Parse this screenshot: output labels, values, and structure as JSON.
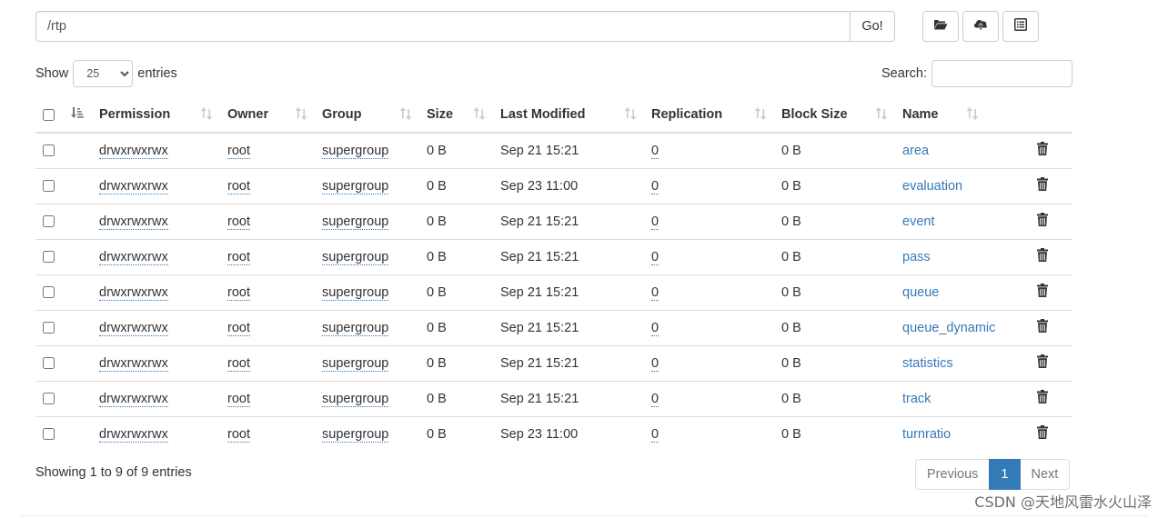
{
  "path": {
    "value": "/rtp",
    "go_label": "Go!"
  },
  "toolbar": {
    "buttons": [
      "folder-open-icon",
      "cloud-upload-icon",
      "list-alt-icon"
    ]
  },
  "length": {
    "prefix": "Show",
    "selected": "25",
    "suffix": "entries"
  },
  "filter": {
    "label": "Search:",
    "value": ""
  },
  "table": {
    "headers": [
      "Permission",
      "Owner",
      "Group",
      "Size",
      "Last Modified",
      "Replication",
      "Block Size",
      "Name"
    ],
    "rows": [
      {
        "permission": "drwxrwxrwx",
        "owner": "root",
        "group": "supergroup",
        "size": "0 B",
        "modified": "Sep 21 15:21",
        "replication": "0",
        "block_size": "0 B",
        "name": "area"
      },
      {
        "permission": "drwxrwxrwx",
        "owner": "root",
        "group": "supergroup",
        "size": "0 B",
        "modified": "Sep 23 11:00",
        "replication": "0",
        "block_size": "0 B",
        "name": "evaluation"
      },
      {
        "permission": "drwxrwxrwx",
        "owner": "root",
        "group": "supergroup",
        "size": "0 B",
        "modified": "Sep 21 15:21",
        "replication": "0",
        "block_size": "0 B",
        "name": "event"
      },
      {
        "permission": "drwxrwxrwx",
        "owner": "root",
        "group": "supergroup",
        "size": "0 B",
        "modified": "Sep 21 15:21",
        "replication": "0",
        "block_size": "0 B",
        "name": "pass"
      },
      {
        "permission": "drwxrwxrwx",
        "owner": "root",
        "group": "supergroup",
        "size": "0 B",
        "modified": "Sep 21 15:21",
        "replication": "0",
        "block_size": "0 B",
        "name": "queue"
      },
      {
        "permission": "drwxrwxrwx",
        "owner": "root",
        "group": "supergroup",
        "size": "0 B",
        "modified": "Sep 21 15:21",
        "replication": "0",
        "block_size": "0 B",
        "name": "queue_dynamic"
      },
      {
        "permission": "drwxrwxrwx",
        "owner": "root",
        "group": "supergroup",
        "size": "0 B",
        "modified": "Sep 21 15:21",
        "replication": "0",
        "block_size": "0 B",
        "name": "statistics"
      },
      {
        "permission": "drwxrwxrwx",
        "owner": "root",
        "group": "supergroup",
        "size": "0 B",
        "modified": "Sep 21 15:21",
        "replication": "0",
        "block_size": "0 B",
        "name": "track"
      },
      {
        "permission": "drwxrwxrwx",
        "owner": "root",
        "group": "supergroup",
        "size": "0 B",
        "modified": "Sep 23 11:00",
        "replication": "0",
        "block_size": "0 B",
        "name": "turnratio"
      }
    ]
  },
  "info": "Showing 1 to 9 of 9 entries",
  "pagination": {
    "previous": "Previous",
    "current": "1",
    "next": "Next"
  },
  "watermark": "CSDN @天地风雷水火山泽",
  "colors": {
    "link": "#337ab7",
    "border": "#dddddd",
    "active_page": "#337ab7",
    "text": "#333333"
  }
}
